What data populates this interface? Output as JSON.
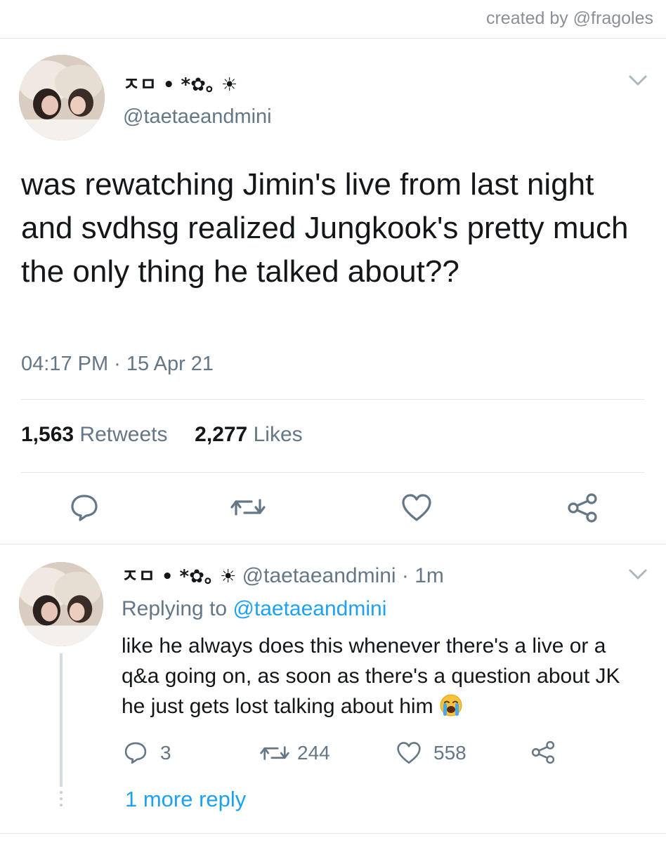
{
  "credit": "created by @fragoles",
  "tweet": {
    "display_name": "ㅈㅁ • *✿｡ ☀︎",
    "handle": "@taetaeandmini",
    "text": "was rewatching Jimin's live from last night and svdhsg realized Jungkook's pretty much the only thing he talked about??",
    "timestamp": "04:17 PM · 15 Apr 21",
    "retweets_count": "1,563",
    "retweets_label": "Retweets",
    "likes_count": "2,277",
    "likes_label": "Likes"
  },
  "reply": {
    "display_name": "ㅈㅁ • *✿｡ ☀︎",
    "handle": "@taetaeandmini",
    "time": "· 1m",
    "replying_prefix": "Replying to",
    "replying_handle": "@taetaeandmini",
    "text": "like he always does this whenever there's a live or a q&a going on, as soon as there's a question about JK he just gets lost talking about him",
    "reply_count": "3",
    "retweet_count": "244",
    "like_count": "558"
  },
  "more_replies": "1 more reply",
  "icons": {
    "reply": "reply-icon",
    "retweet": "retweet-icon",
    "like": "heart-icon",
    "share": "share-icon",
    "menu": "chevron-down-icon",
    "emoji": "loudly-crying-face-emoji"
  },
  "colors": {
    "link": "#1da1f2",
    "secondary_text": "#657786",
    "primary_text": "#14171a",
    "divider": "#e3e8ec"
  }
}
